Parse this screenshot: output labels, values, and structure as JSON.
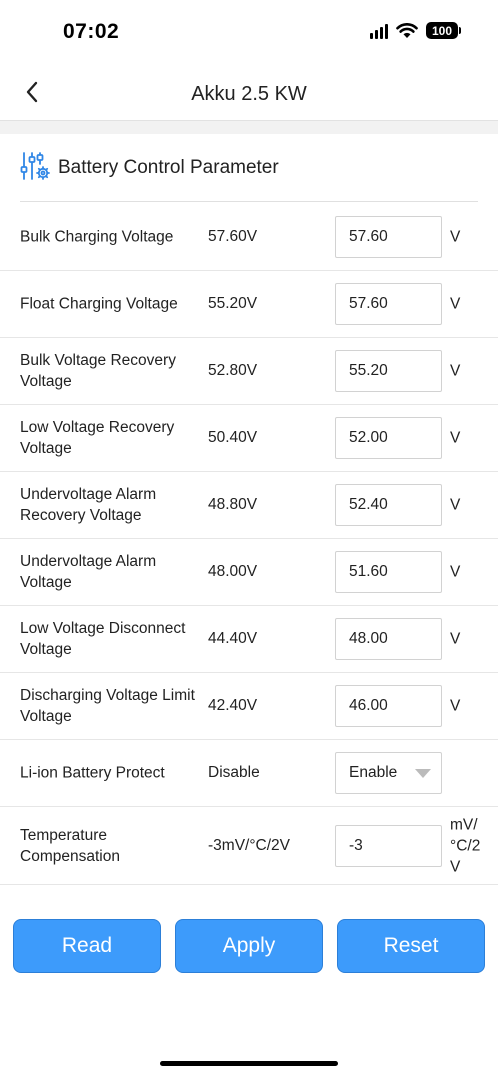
{
  "status": {
    "time": "07:02",
    "battery_level": "100"
  },
  "nav": {
    "title": "Akku 2.5 KW"
  },
  "section": {
    "title": "Battery Control Parameter"
  },
  "rows": [
    {
      "label": "Bulk Charging Voltage",
      "value": "57.60V",
      "input": "57.60",
      "unit": "V"
    },
    {
      "label": "Float Charging Voltage",
      "value": "55.20V",
      "input": "57.60",
      "unit": "V"
    },
    {
      "label": "Bulk Voltage Recovery Voltage",
      "value": "52.80V",
      "input": "55.20",
      "unit": "V"
    },
    {
      "label": "Low Voltage Recovery Voltage",
      "value": "50.40V",
      "input": "52.00",
      "unit": "V"
    },
    {
      "label": "Undervoltage Alarm Recovery Voltage",
      "value": "48.80V",
      "input": "52.40",
      "unit": "V"
    },
    {
      "label": "Undervoltage Alarm Voltage",
      "value": "48.00V",
      "input": "51.60",
      "unit": "V"
    },
    {
      "label": "Low Voltage Disconnect Voltage",
      "value": "44.40V",
      "input": "48.00",
      "unit": "V"
    },
    {
      "label": "Discharging Voltage Limit Voltage",
      "value": "42.40V",
      "input": "46.00",
      "unit": "V"
    },
    {
      "label": "Li-ion Battery Protect",
      "value": "Disable",
      "input": "Enable",
      "unit": ""
    },
    {
      "label": "Temperature Compensation",
      "value": "-3mV/°C/2V",
      "input": "-3",
      "unit": "mV/ °C/2 V"
    }
  ],
  "buttons": {
    "read": "Read",
    "apply": "Apply",
    "reset": "Reset"
  },
  "colors": {
    "accent": "#3d9bfb",
    "icon": "#2f86e6"
  }
}
